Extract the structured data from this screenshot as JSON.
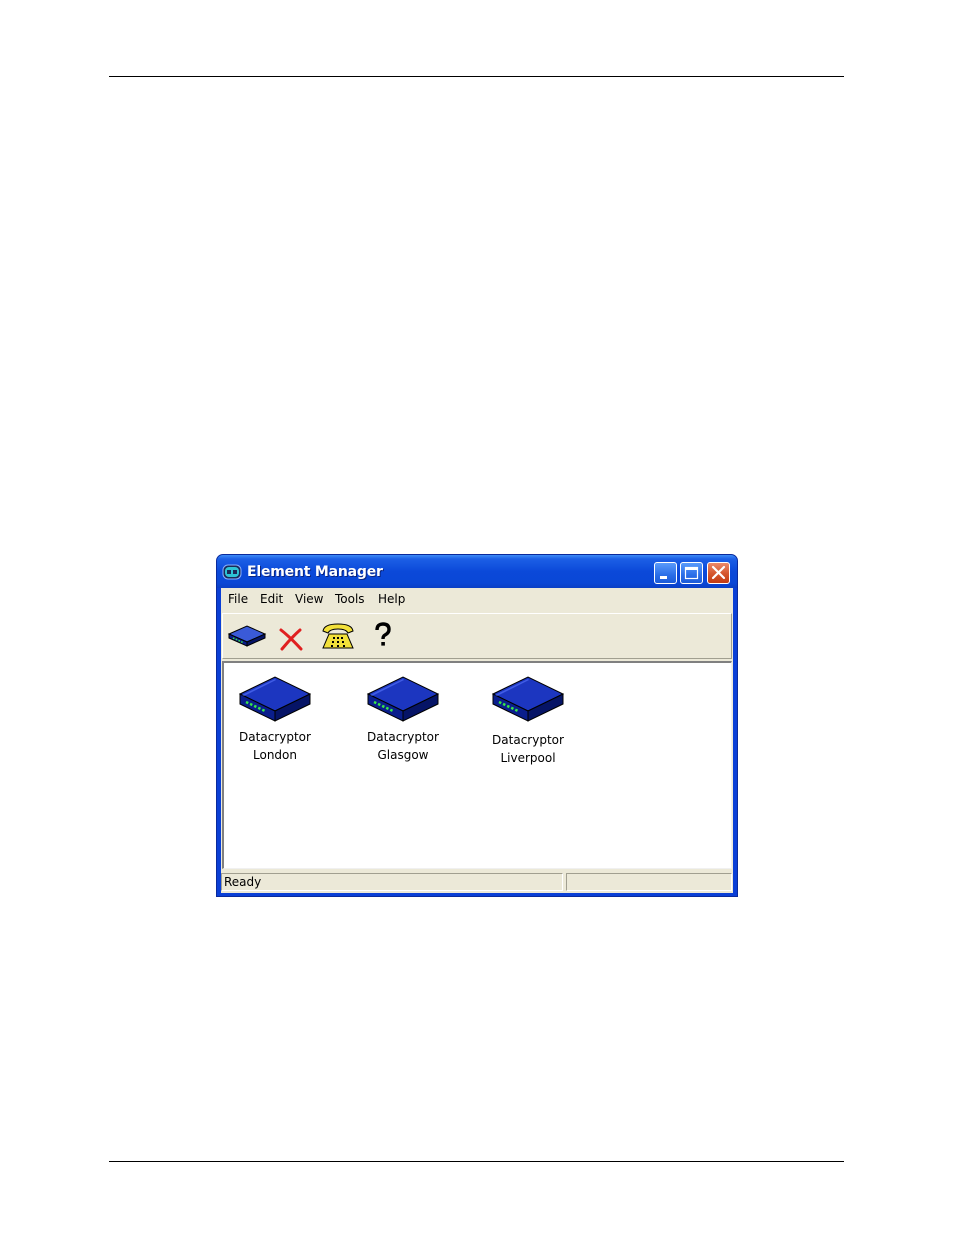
{
  "window": {
    "title": "Element Manager",
    "app_icon": "dc-logo-icon",
    "controls": [
      "minimize-icon",
      "maximize-icon",
      "close-icon"
    ]
  },
  "menu": {
    "items": [
      {
        "label": "File"
      },
      {
        "label": "Edit"
      },
      {
        "label": "View"
      },
      {
        "label": "Tools"
      },
      {
        "label": "Help"
      }
    ]
  },
  "toolbar": {
    "buttons": [
      {
        "icon": "add-device-icon"
      },
      {
        "icon": "delete-icon"
      },
      {
        "icon": "telephone-icon"
      },
      {
        "icon": "help-icon"
      }
    ]
  },
  "devices": [
    {
      "line1": "Datacryptor",
      "line2": "London",
      "icon": "datacryptor-device-icon"
    },
    {
      "line1": "Datacryptor",
      "line2": "Glasgow",
      "icon": "datacryptor-device-icon"
    },
    {
      "line1": "Datacryptor",
      "line2": "Liverpool",
      "icon": "datacryptor-device-icon"
    }
  ],
  "status": {
    "text": "Ready"
  },
  "colors": {
    "titlebar": "#0a47d6",
    "window_face": "#ece9d8",
    "device_body": "#0a1e8c",
    "device_leds": "#38e848",
    "close_button": "#d4552c"
  }
}
